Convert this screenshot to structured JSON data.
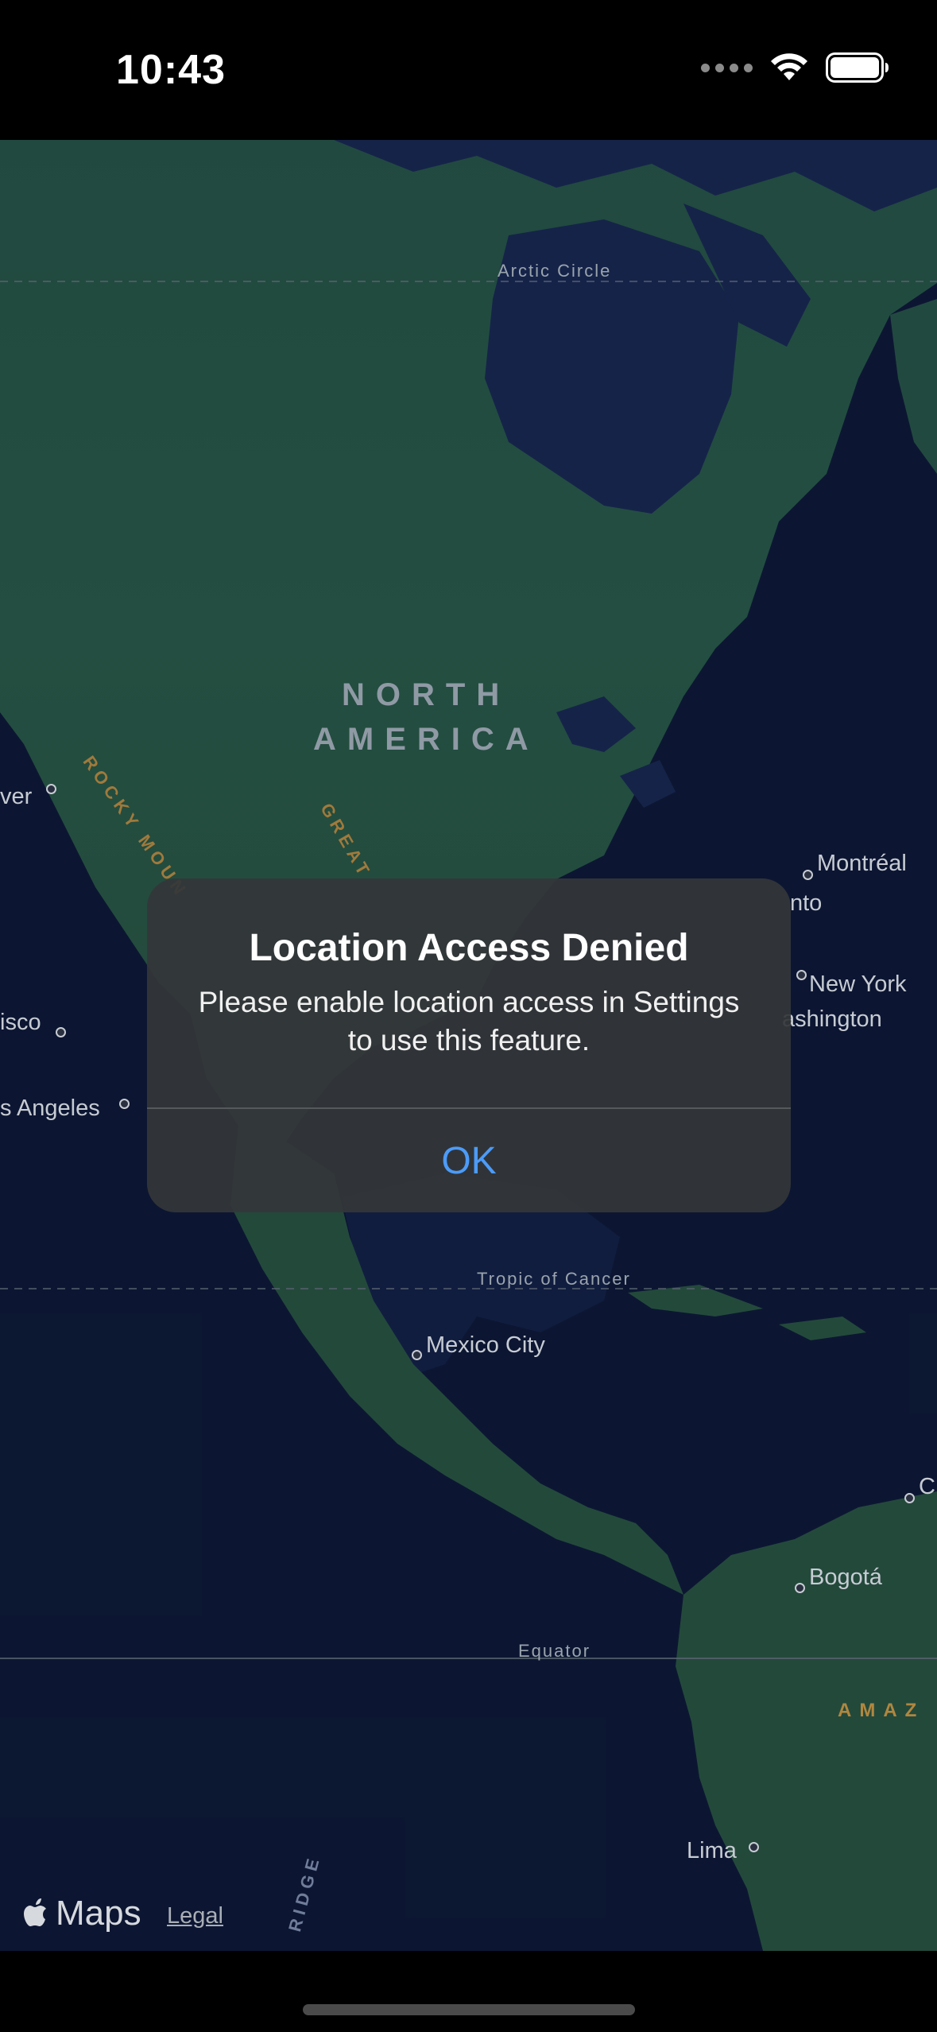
{
  "status_bar": {
    "time": "10:43",
    "icons": [
      "cellular-signal-icon",
      "wifi-icon",
      "battery-icon"
    ]
  },
  "map": {
    "labels": {
      "arctic_circle": "Arctic Circle",
      "north": "NORTH",
      "america": "AMERICA",
      "rocky_mountains": "ROCKY MOUN",
      "great": "GREAT",
      "montreal": "Montréal",
      "toronto": "nto",
      "new_york": "New York",
      "washington": "ashington",
      "vancouver": "ver",
      "san_francisco": "isco",
      "los_angeles": "s Angeles",
      "tropic_of_cancer": "Tropic of Cancer",
      "mexico_city": "Mexico City",
      "c_city": "C",
      "bogota": "Bogotá",
      "equator": "Equator",
      "amazon": "AMAZ",
      "ridge": "RIDGE",
      "lima": "Lima"
    },
    "attribution": {
      "maps_label": "Maps",
      "legal_label": "Legal"
    },
    "colors": {
      "ocean": "#0f1c3d",
      "land": "#27584d"
    }
  },
  "alert": {
    "title": "Location Access Denied",
    "message": "Please enable location access in Settings to use this feature.",
    "ok_label": "OK",
    "ok_color": "#4c9bf8"
  }
}
